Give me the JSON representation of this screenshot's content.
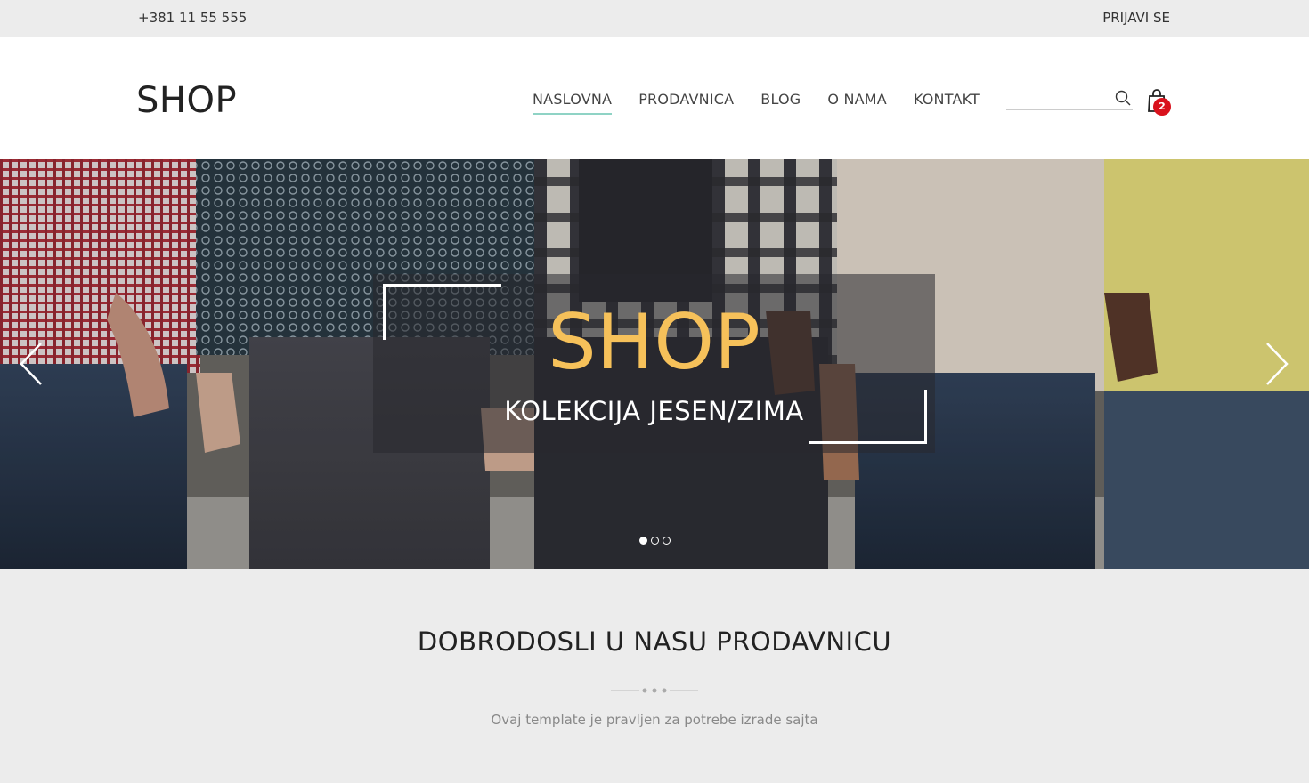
{
  "topbar": {
    "phone": "+381 11 55 555",
    "login": "PRIJAVI SE"
  },
  "header": {
    "logo": "SHOP",
    "nav": [
      {
        "label": "NASLOVNA",
        "active": true
      },
      {
        "label": "PRODAVNICA",
        "active": false
      },
      {
        "label": "BLOG",
        "active": false
      },
      {
        "label": "O NAMA",
        "active": false
      },
      {
        "label": "KONTAKT",
        "active": false
      }
    ],
    "search": {
      "value": "",
      "placeholder": ""
    },
    "cart": {
      "count": "2"
    }
  },
  "hero": {
    "title": "SHOP",
    "subtitle": "KOLEKCIJA JESEN/ZIMA",
    "slides": 3,
    "active_slide": 1
  },
  "welcome": {
    "title": "DOBRODOSLI U NASU PRODAVNICU",
    "text": "Ovaj template je pravljen za potrebe izrade sajta"
  },
  "colors": {
    "accent_underline": "#8fd3c5",
    "hero_title": "#f6c15a",
    "badge": "#d9121d",
    "topbar_bg": "#ececec"
  }
}
